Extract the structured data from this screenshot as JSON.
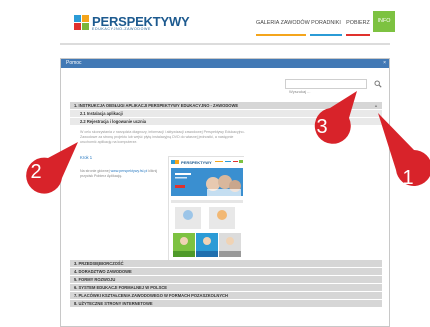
{
  "site": {
    "logo_text": "PERSPEKTYWY",
    "logo_sub": "EDUKACYJNO-ZAWODOWE",
    "nav": [
      {
        "label": "GALERIA ZAWODÓW",
        "color": "#f4a51c"
      },
      {
        "label": "PORADNIKI",
        "color": "#2b9bd6"
      },
      {
        "label": "POBIERZ",
        "color": "#e0312d"
      },
      {
        "label": "INFO",
        "color": "#7dc241"
      }
    ]
  },
  "help": {
    "title": "Pomoc",
    "close": "×",
    "search_placeholder": "Wyszukaj ...",
    "toc_top": [
      {
        "label": "1. INSTRUKCJA OBSŁUGI APLIKACJI PERSPEKTYWY EDUKACYJNO - ZAWODOWE",
        "level": 1
      },
      {
        "label": "2.1 Instalacja aplikacji",
        "level": 2
      },
      {
        "label": "2.2 Rejestracja i logowanie ucznia",
        "level": 2
      }
    ],
    "content_text": "W celu skorzystania z narzędzia diagnozy, informacji i aktywizacji zawodowej Perspektywy Edukacyjno-Zawodowe za stronę projektu lub wejść płytę instalacyjną DVD do własnej jednostki, a następnie uruchomić aplikację na komputerze.",
    "krok": "Krok 1",
    "para2_pre": "Na stronie głównej ",
    "para2_link": "www.perspektywy.fsl.pl",
    "para2_post": " kliknij przycisk Pobierz Aplikację.",
    "screenshot_title": "PERSPEKTYWY",
    "toc_bottom": [
      "3. PRZEDSIĘBIORCZOŚĆ",
      "4. DORADZTWO ZAWODOWE",
      "5. FORMY ROZWOJU",
      "6. SYSTEM EDUKACJI FORMALNEJ W POLSCE",
      "7. PLACÓWKI KSZTAŁCENIA ZAWODOWEGO W FORMACH POZASZKOLNYCH",
      "8. UŻYTECZNE STRONY INTERNETOWE"
    ]
  }
}
